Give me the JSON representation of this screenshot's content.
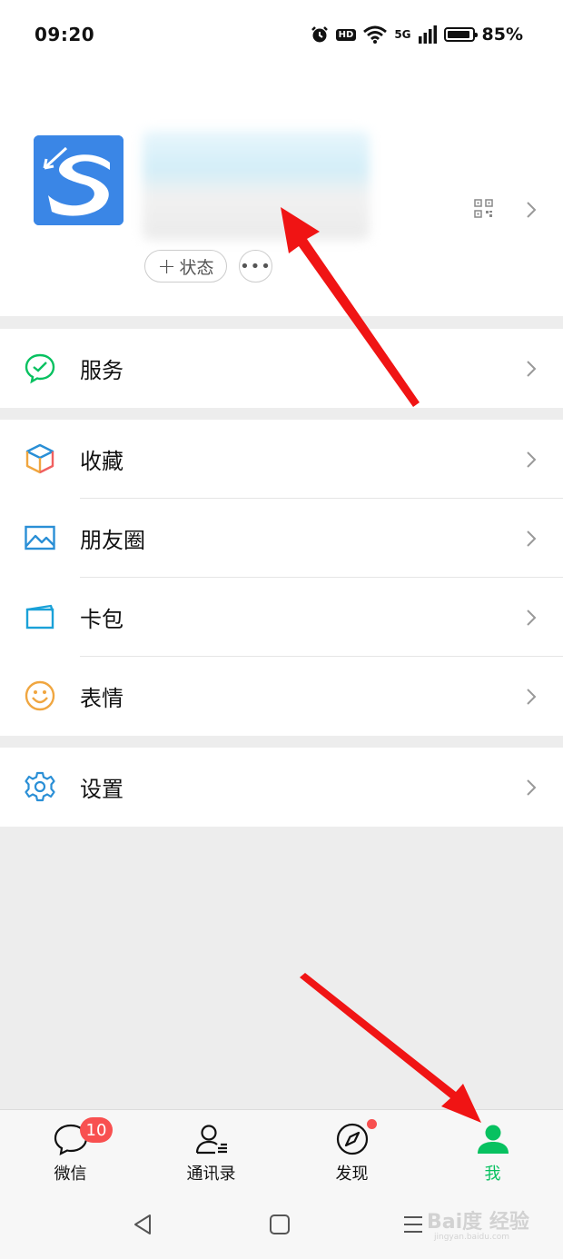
{
  "status_bar": {
    "time": "09:20",
    "battery": "85%",
    "network": "5G",
    "hd": "HD"
  },
  "profile": {
    "status_button_label": "状态",
    "more_button_label": "•••"
  },
  "menu": {
    "service": {
      "label": "服务",
      "icon": "service-icon",
      "color": "#07c160"
    },
    "favorites": {
      "label": "收藏",
      "icon": "favorites-cube-icon"
    },
    "moments": {
      "label": "朋友圈",
      "icon": "moments-image-icon",
      "color": "#2a8fd6"
    },
    "cards": {
      "label": "卡包",
      "icon": "card-wallet-icon",
      "color": "#1aa1d8"
    },
    "stickers": {
      "label": "表情",
      "icon": "sticker-smiley-icon",
      "color": "#f0a640"
    },
    "settings": {
      "label": "设置",
      "icon": "gear-icon",
      "color": "#2a8fd6"
    }
  },
  "tab_bar": {
    "chats": {
      "label": "微信",
      "badge": "10"
    },
    "contacts": {
      "label": "通讯录"
    },
    "discover": {
      "label": "发现"
    },
    "me": {
      "label": "我",
      "active": true,
      "accent": "#07c160"
    }
  },
  "watermark": {
    "text": "Bai度 经验",
    "sub": "jingyan.baidu.com"
  }
}
